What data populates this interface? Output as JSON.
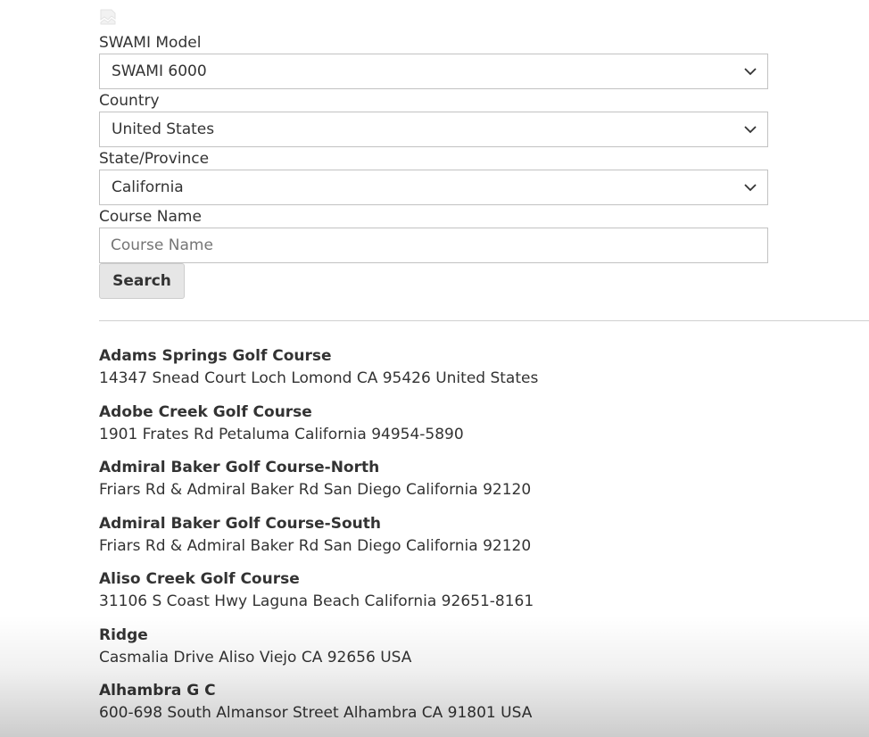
{
  "form": {
    "model": {
      "label": "SWAMI Model",
      "value": "SWAMI 6000"
    },
    "country": {
      "label": "Country",
      "value": "United States"
    },
    "state": {
      "label": "State/Province",
      "value": "California"
    },
    "course_name": {
      "label": "Course Name",
      "value": "",
      "placeholder": "Course Name"
    },
    "search_label": "Search"
  },
  "icons": {
    "select_arrow": "chevron-down-icon",
    "missing_image": "broken-image-icon"
  },
  "colors": {
    "text": "#333333",
    "border": "#c2c2c2",
    "button_bg": "#e6e6e6"
  },
  "results": [
    {
      "name": "Adams Springs Golf Course",
      "address": "14347 Snead Court Loch Lomond CA 95426 United States"
    },
    {
      "name": "Adobe Creek Golf Course",
      "address": "1901 Frates Rd Petaluma California 94954-5890"
    },
    {
      "name": "Admiral Baker Golf Course-North",
      "address": "Friars Rd & Admiral Baker Rd San Diego California 92120"
    },
    {
      "name": "Admiral Baker Golf Course-South",
      "address": "Friars Rd & Admiral Baker Rd San Diego California 92120"
    },
    {
      "name": "Aliso Creek Golf Course",
      "address": "31106 S Coast Hwy Laguna Beach California 92651-8161"
    },
    {
      "name": "Ridge",
      "address": "Casmalia Drive Aliso Viejo CA 92656 USA"
    },
    {
      "name": "Alhambra G C",
      "address": "600-698 South Almansor Street Alhambra CA 91801 USA"
    }
  ]
}
